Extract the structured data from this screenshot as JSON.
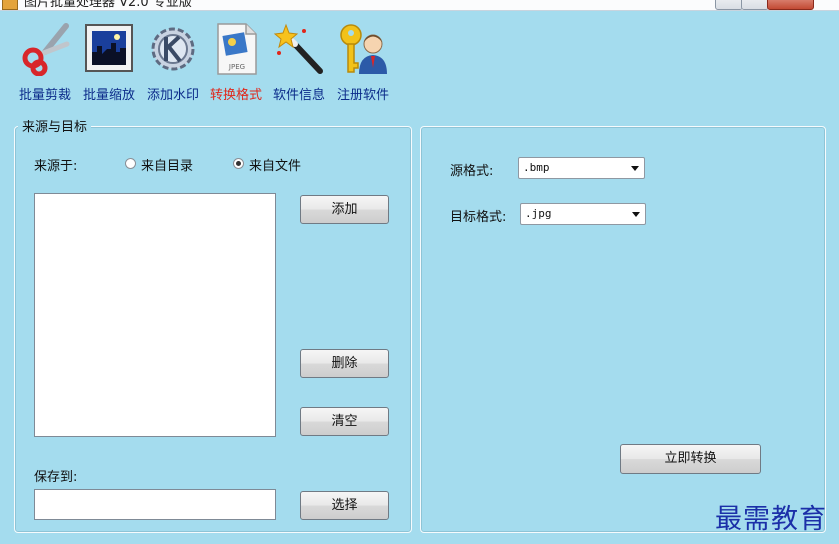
{
  "titlebar": {
    "title": "图片批量处理器 V2.0 专业版"
  },
  "toolbar": {
    "items": [
      {
        "label": "批量剪裁",
        "icon": "scissors-icon"
      },
      {
        "label": "批量缩放",
        "icon": "picture-frame-icon"
      },
      {
        "label": "添加水印",
        "icon": "gear-k-icon"
      },
      {
        "label": "转换格式",
        "icon": "jpeg-file-icon",
        "active": true
      },
      {
        "label": "软件信息",
        "icon": "magic-wand-icon"
      },
      {
        "label": "注册软件",
        "icon": "key-user-icon"
      }
    ],
    "active_color": "#e0261a",
    "label_color": "#0b2b8a"
  },
  "source_group": {
    "legend": "来源与目标",
    "source_label": "来源于:",
    "radio_dir": "来自目录",
    "radio_file": "来自文件",
    "selected": "radio_file",
    "add_button": "添加",
    "delete_button": "删除",
    "clear_button": "清空",
    "save_label": "保存到:",
    "save_value": "",
    "choose_button": "选择"
  },
  "format_group": {
    "source_format_label": "源格式:",
    "source_format_value": ".bmp",
    "target_format_label": "目标格式:",
    "target_format_value": ".jpg",
    "convert_button": "立即转换"
  },
  "watermark": {
    "text": "最需教育"
  },
  "colors": {
    "background": "#a4dcee",
    "watermark": "#1b2fa8"
  }
}
